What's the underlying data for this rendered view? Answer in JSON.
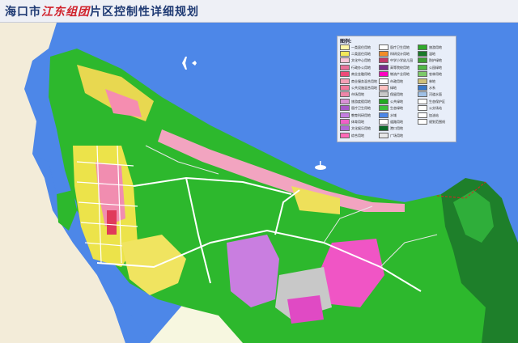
{
  "title": {
    "prefix": "海口市",
    "highlight": "江东组团",
    "suffix": "片区控制性详细规划"
  },
  "legend": {
    "title": "图例:",
    "items": [
      {
        "label": "一类居住用地",
        "color": "#fff7a8"
      },
      {
        "label": "二类居住用地",
        "color": "#f2e85a"
      },
      {
        "label": "文化中心用地",
        "color": "#f6c6d8"
      },
      {
        "label": "行政办公用地",
        "color": "#e8709a"
      },
      {
        "label": "商业金融用地",
        "color": "#ef4a78"
      },
      {
        "label": "商业服务混合用地",
        "color": "#f6a0b6"
      },
      {
        "label": "公共设施混合用地",
        "color": "#f37b9d"
      },
      {
        "label": "市场用地",
        "color": "#ee86a8"
      },
      {
        "label": "旅游度假用地",
        "color": "#d990d6"
      },
      {
        "label": "医疗卫生用地",
        "color": "#a65ac9"
      },
      {
        "label": "教育科研用地",
        "color": "#c47ee0"
      },
      {
        "label": "体育用地",
        "color": "#f060c8"
      },
      {
        "label": "文化娱乐用地",
        "color": "#b06ad8"
      },
      {
        "label": "综合用地",
        "color": "#ff6ab8"
      },
      {
        "label": "医疗卫生用地",
        "color": "#ffffff"
      },
      {
        "label": "科研设计用地",
        "color": "#f28c28"
      },
      {
        "label": "中学小学幼儿园",
        "color": "#c23a6a"
      },
      {
        "label": "高等院校用地",
        "color": "#7a2e8a"
      },
      {
        "label": "物流产业用地",
        "color": "#ff00c0"
      },
      {
        "label": "市政用地",
        "color": "#ffffff"
      },
      {
        "label": "绿地",
        "color": "#ffc0c0"
      },
      {
        "label": "保留用地",
        "color": "#c8c8c8"
      },
      {
        "label": "公共绿地",
        "color": "#22aa22"
      },
      {
        "label": "生态绿地",
        "color": "#3cc03c"
      },
      {
        "label": "水域",
        "color": "#4d87e8"
      },
      {
        "label": "道路用地",
        "color": "#ffffff"
      },
      {
        "label": "港口用地",
        "color": "#0a6a2a"
      },
      {
        "label": "广场用地",
        "color": "#e8e8e8"
      },
      {
        "label": "旅游用地",
        "color": "#2faa2a"
      },
      {
        "label": "湿地",
        "color": "#1a7a2a"
      },
      {
        "label": "防护绿地",
        "color": "#3e9e35"
      },
      {
        "label": "公园绿地",
        "color": "#50b848"
      },
      {
        "label": "农林用地",
        "color": "#7cc96a"
      },
      {
        "label": "林地",
        "color": "#cfc07a"
      },
      {
        "label": "水系",
        "color": "#3a78c8"
      },
      {
        "label": "河道水面",
        "color": "#9fc0e6"
      },
      {
        "label": "生态保护区",
        "color": "#ffffff"
      },
      {
        "label": "公交场站",
        "color": "#ffffff"
      },
      {
        "label": "加油站",
        "color": "#ffffff"
      },
      {
        "label": "规划范围线",
        "color": "#ffffff"
      }
    ]
  }
}
